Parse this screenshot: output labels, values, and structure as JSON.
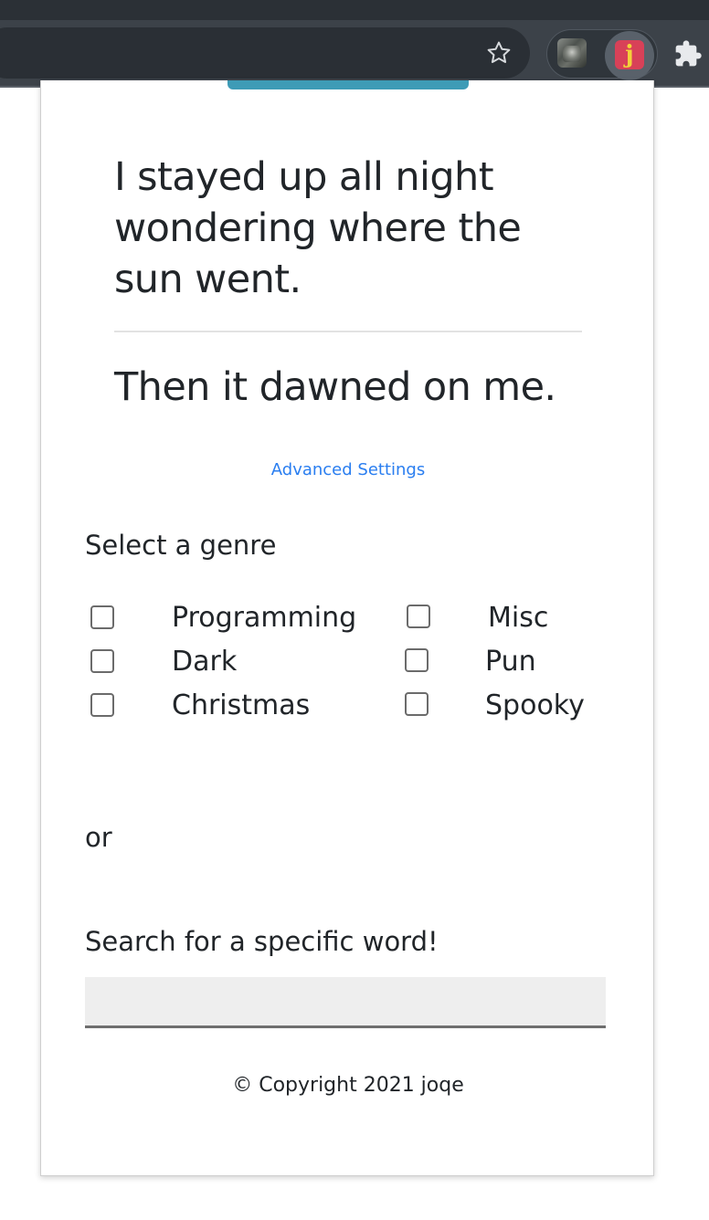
{
  "browser": {
    "bookmark_icon": "star-outline-icon",
    "extensions": [
      "photo-extension-icon",
      "joqe-extension-icon",
      "puzzle-icon"
    ],
    "joqe_icon_letter": "j",
    "colors": {
      "toolbar": "#3c4249",
      "joqe_icon_bg": "#d84158",
      "joqe_icon_fg": "#f3d23a"
    }
  },
  "popup": {
    "accent_color": "#3e9bb6",
    "joke": {
      "setup": "I stayed up all night wondering where the sun went.",
      "punchline": "Then it dawned on me."
    },
    "advanced_settings_link": "Advanced Settings",
    "genre_prompt": "Select a genre",
    "genres": [
      {
        "label": "Programming",
        "checked": false
      },
      {
        "label": "Dark",
        "checked": false
      },
      {
        "label": "Christmas",
        "checked": false
      },
      {
        "label": "Misc",
        "checked": false
      },
      {
        "label": "Pun",
        "checked": false
      },
      {
        "label": "Spooky",
        "checked": false
      }
    ],
    "or_text": "or",
    "search_label": "Search for a specific word!",
    "search_value": "",
    "footer": "© Copyright 2021 joqe"
  }
}
